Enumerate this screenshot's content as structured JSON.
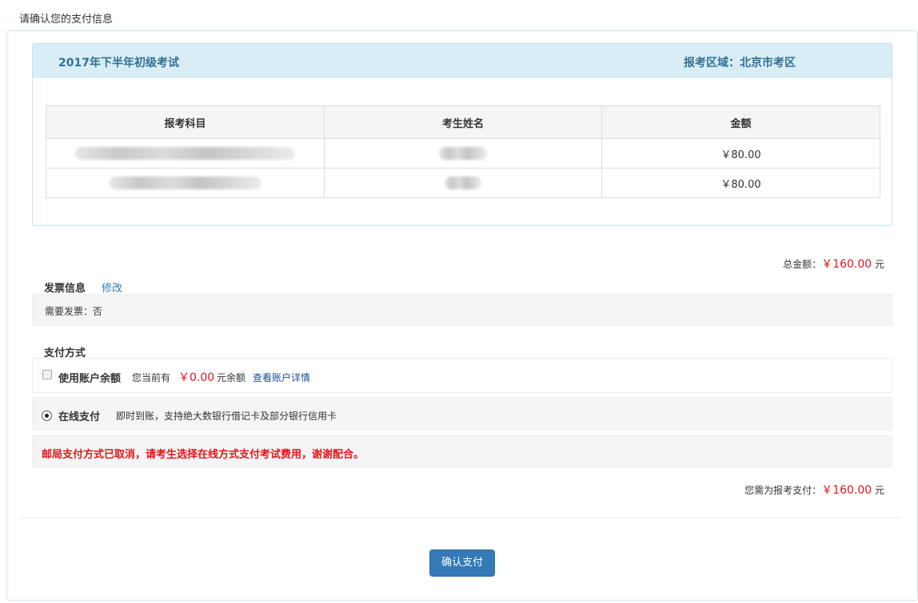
{
  "page": {
    "heading": "请确认您的支付信息"
  },
  "exam": {
    "title": "2017年下半年初级考试",
    "region": "报考区域：北京市考区"
  },
  "table": {
    "headers": [
      "报考科目",
      "考生姓名",
      "金额"
    ],
    "rows": [
      {
        "subject": "",
        "name": "",
        "amount": "￥80.00"
      },
      {
        "subject": "",
        "name": "",
        "amount": "￥80.00"
      }
    ]
  },
  "total": {
    "label": "总金额：",
    "amount": "￥160.00",
    "unit": "元"
  },
  "invoice": {
    "title": "发票信息",
    "edit_label": "修改",
    "need_invoice": "需要发票：否"
  },
  "payment": {
    "title": "支付方式",
    "balance": {
      "label": "使用账户余额",
      "desc": "您当前有",
      "amount": "￥0.00",
      "unit": "元余额",
      "link": "查看账户详情",
      "checked": false
    },
    "online": {
      "label": "在线支付",
      "desc": "即时到账，支持绝大数银行借记卡及部分银行信用卡",
      "selected": true
    },
    "notice": "邮局支付方式已取消，请考生选择在线方式支付考试费用，谢谢配合。"
  },
  "due": {
    "label": "您需为报考支付：",
    "amount": "￥160.00",
    "unit": "元"
  },
  "confirm_button": "确认支付",
  "colors": {
    "accent": "#337ab7",
    "price": "#e4141b",
    "panel_header": "#d9edf7",
    "panel_title": "#31708f"
  }
}
